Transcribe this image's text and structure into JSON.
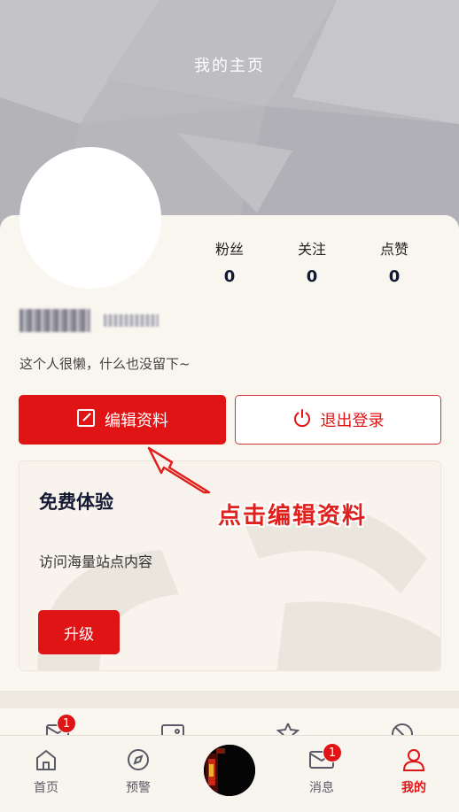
{
  "header": {
    "title": "我的主页"
  },
  "profile": {
    "stats": [
      {
        "label": "粉丝",
        "value": "0"
      },
      {
        "label": "关注",
        "value": "0"
      },
      {
        "label": "点赞",
        "value": "0"
      }
    ],
    "bio": "这个人很懒，什么也没留下~",
    "edit_label": "编辑资料",
    "logout_label": "退出登录"
  },
  "trial": {
    "title": "免费体验",
    "description": "访问海量站点内容",
    "upgrade_label": "升级"
  },
  "annotation": {
    "text": "点击编辑资料"
  },
  "peek_row": {
    "message_badge": "1"
  },
  "tabbar": {
    "items": [
      {
        "label": "首页",
        "icon": "home-icon"
      },
      {
        "label": "预警",
        "icon": "compass-icon"
      },
      {
        "label": "",
        "icon": "center-thumbnail"
      },
      {
        "label": "消息",
        "icon": "mail-icon",
        "badge": "1"
      },
      {
        "label": "我的",
        "icon": "person-icon",
        "active": true
      }
    ]
  },
  "colors": {
    "accent": "#e01414",
    "header_bg": "#b9b9be",
    "card_bg": "#f9f6f0"
  }
}
